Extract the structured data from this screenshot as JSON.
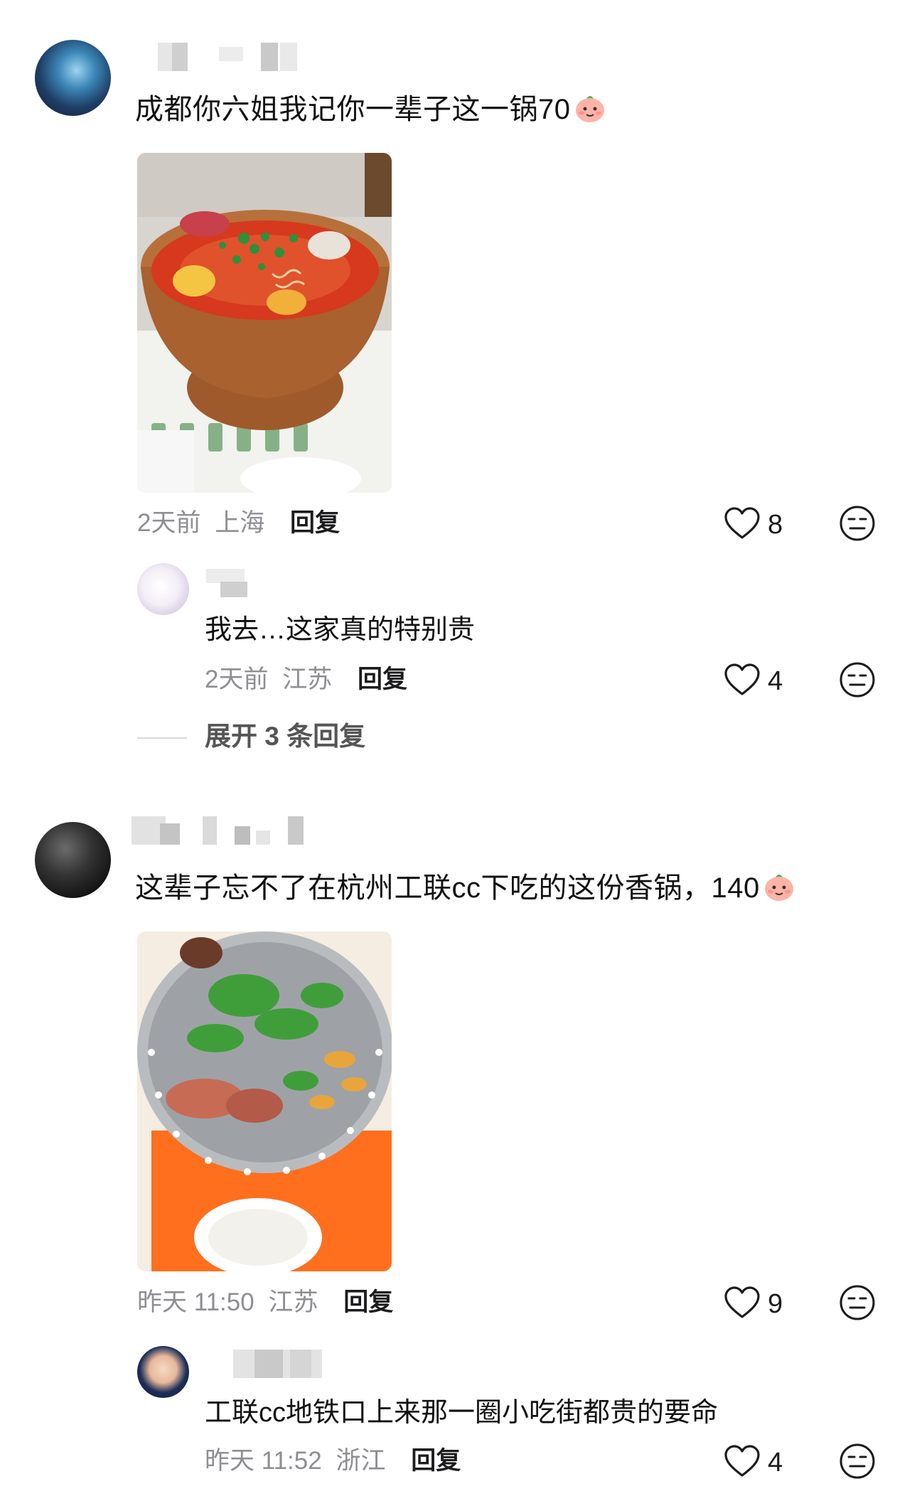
{
  "comments": [
    {
      "text": "成都你六姐我记你一辈子这一锅70",
      "emoji_icon": "peach-face-emoji",
      "meta_time": "2天前",
      "meta_location": "上海",
      "reply_label": "回复",
      "like_count": "8",
      "replies": [
        {
          "text": "我去…这家真的特别贵",
          "meta_time": "2天前",
          "meta_location": "江苏",
          "reply_label": "回复",
          "like_count": "4"
        }
      ],
      "expand_label": "展开 3 条回复"
    },
    {
      "text": "这辈子忘不了在杭州工联cc下吃的这份香锅，140",
      "emoji_icon": "peach-face-emoji",
      "meta_time": "昨天 11:50",
      "meta_location": "江苏",
      "reply_label": "回复",
      "like_count": "9",
      "replies": [
        {
          "text": "工联cc地铁口上来那一圈小吃街都贵的要命",
          "meta_time": "昨天 11:52",
          "meta_location": "浙江",
          "reply_label": "回复",
          "like_count": "4"
        }
      ]
    }
  ],
  "icons": {
    "like": "heart-outline-icon",
    "dislike": "neutral-face-icon"
  },
  "colors": {
    "meta_gray": "#8e8e93",
    "text": "#1c1c1e",
    "copper_pot": "#b8703a",
    "broth": "#d6391d"
  }
}
